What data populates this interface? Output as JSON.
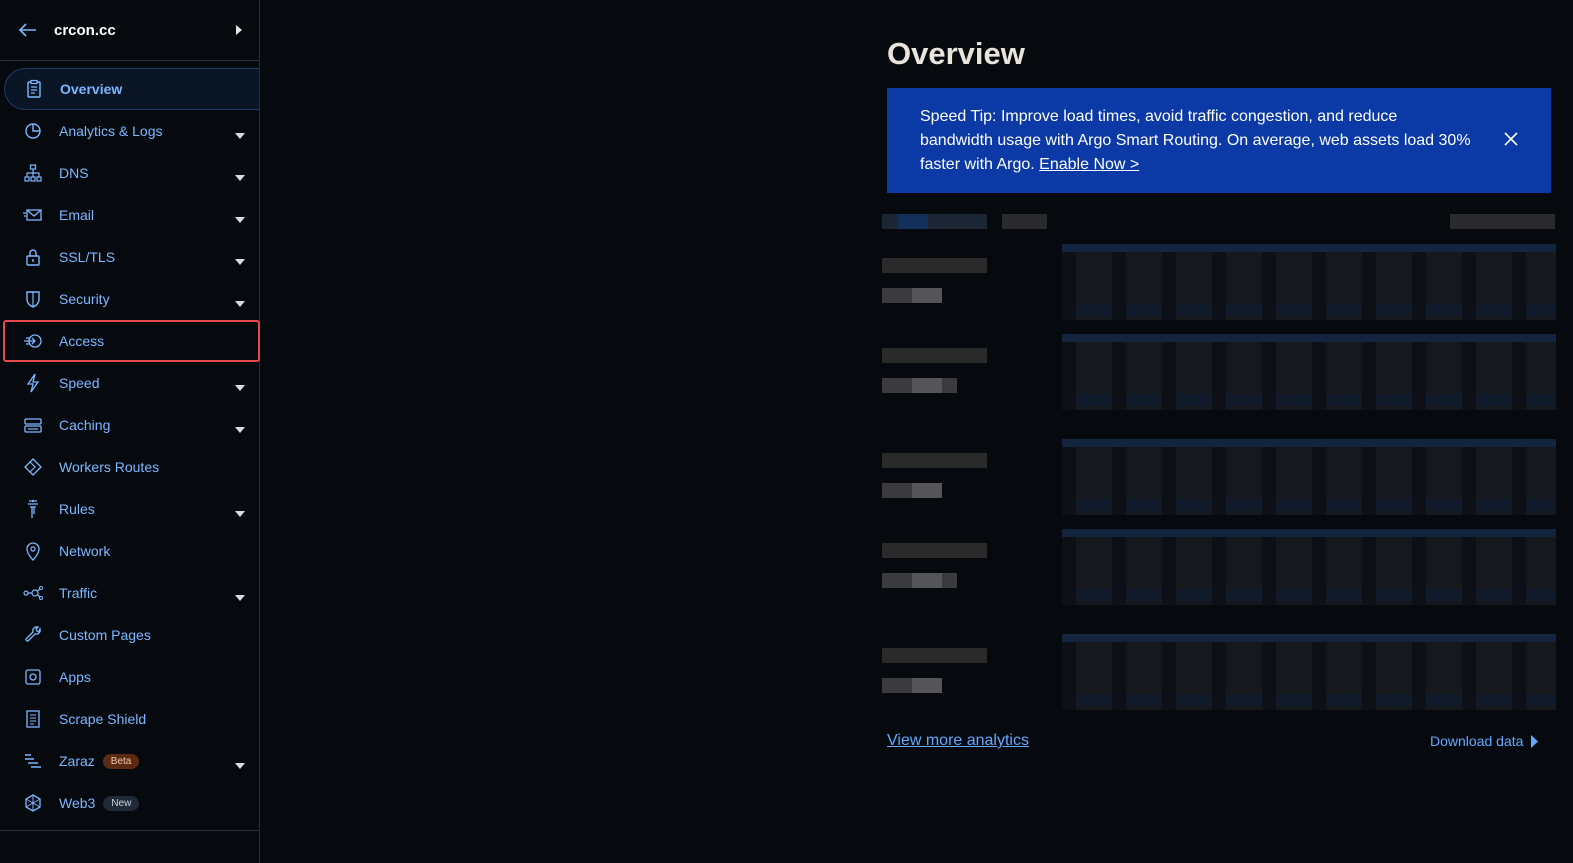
{
  "sidebar": {
    "site": "crcon.cc",
    "items": [
      {
        "label": "Overview",
        "icon": "clipboard-icon",
        "has_caret": false
      },
      {
        "label": "Analytics & Logs",
        "icon": "pie-chart-icon",
        "has_caret": true
      },
      {
        "label": "DNS",
        "icon": "network-tree-icon",
        "has_caret": true
      },
      {
        "label": "Email",
        "icon": "envelope-icon",
        "has_caret": true
      },
      {
        "label": "SSL/TLS",
        "icon": "lock-icon",
        "has_caret": true
      },
      {
        "label": "Security",
        "icon": "shield-icon",
        "has_caret": true
      },
      {
        "label": "Access",
        "icon": "access-arrow-icon",
        "has_caret": false
      },
      {
        "label": "Speed",
        "icon": "lightning-icon",
        "has_caret": true
      },
      {
        "label": "Caching",
        "icon": "server-stack-icon",
        "has_caret": true
      },
      {
        "label": "Workers Routes",
        "icon": "workers-diamond-icon",
        "has_caret": false
      },
      {
        "label": "Rules",
        "icon": "funnel-icon",
        "has_caret": true
      },
      {
        "label": "Network",
        "icon": "map-pin-icon",
        "has_caret": false
      },
      {
        "label": "Traffic",
        "icon": "traffic-nodes-icon",
        "has_caret": true
      },
      {
        "label": "Custom Pages",
        "icon": "wrench-icon",
        "has_caret": false
      },
      {
        "label": "Apps",
        "icon": "apps-square-icon",
        "has_caret": false
      },
      {
        "label": "Scrape Shield",
        "icon": "document-icon",
        "has_caret": false
      },
      {
        "label": "Zaraz",
        "icon": "zaraz-lines-icon",
        "has_caret": true,
        "badge": "Beta"
      },
      {
        "label": "Web3",
        "icon": "web3-cube-icon",
        "has_caret": false,
        "badge": "New"
      }
    ]
  },
  "main": {
    "title": "Overview",
    "tip": {
      "text": "Speed Tip: Improve load times, avoid traffic congestion, and reduce bandwidth usage with Argo Smart Routing. On average, web assets load 30% faster with Argo.",
      "link": "Enable Now >"
    },
    "view_more": "View more analytics",
    "download": "Download data"
  },
  "colors": {
    "accent": "#7db7ff",
    "link": "#62a8ff",
    "tip_bg": "#0b3aa6",
    "highlight": "#e5484d"
  }
}
